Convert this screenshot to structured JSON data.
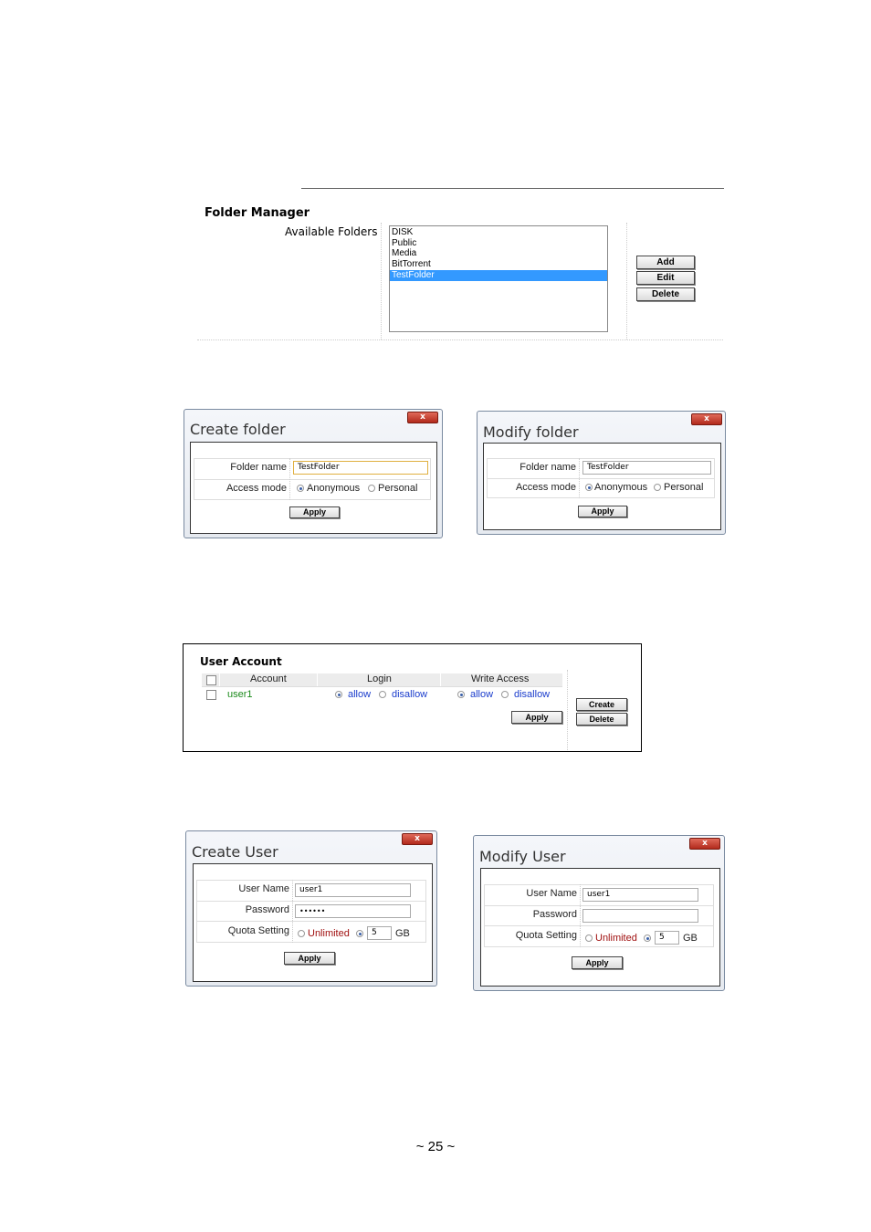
{
  "folder_manager": {
    "title": "Folder Manager",
    "available_label": "Available Folders",
    "folders": [
      "DISK",
      "Public",
      "Media",
      "BitTorrent",
      "TestFolder"
    ],
    "selected_folder": "TestFolder",
    "buttons": {
      "add": "Add",
      "edit": "Edit",
      "delete": "Delete"
    }
  },
  "create_folder": {
    "title": "Create folder",
    "close": "x",
    "folder_name_label": "Folder name",
    "folder_name_value": "TestFolder",
    "access_mode_label": "Access mode",
    "opt_anonymous": "Anonymous",
    "opt_personal": "Personal",
    "apply": "Apply"
  },
  "modify_folder": {
    "title": "Modify folder",
    "close": "x",
    "folder_name_label": "Folder name",
    "folder_name_value": "TestFolder",
    "access_mode_label": "Access mode",
    "opt_anonymous": "Anonymous",
    "opt_personal": "Personal",
    "apply": "Apply"
  },
  "user_account": {
    "title": "User Account",
    "col_account": "Account",
    "col_login": "Login",
    "col_write": "Write Access",
    "user": "user1",
    "allow": "allow",
    "disallow": "disallow",
    "apply": "Apply",
    "create": "Create",
    "delete": "Delete"
  },
  "create_user": {
    "title": "Create User",
    "close": "x",
    "username_label": "User Name",
    "username_value": "user1",
    "password_label": "Password",
    "password_value": "••••••",
    "quota_label": "Quota Setting",
    "unlimited": "Unlimited",
    "quota_value": "5",
    "gb": "GB",
    "apply": "Apply"
  },
  "modify_user": {
    "title": "Modify User",
    "close": "x",
    "username_label": "User Name",
    "username_value": "user1",
    "password_label": "Password",
    "password_value": "",
    "quota_label": "Quota Setting",
    "unlimited": "Unlimited",
    "quota_value": "5",
    "gb": "GB",
    "apply": "Apply"
  },
  "page_number": "~ 25 ~"
}
